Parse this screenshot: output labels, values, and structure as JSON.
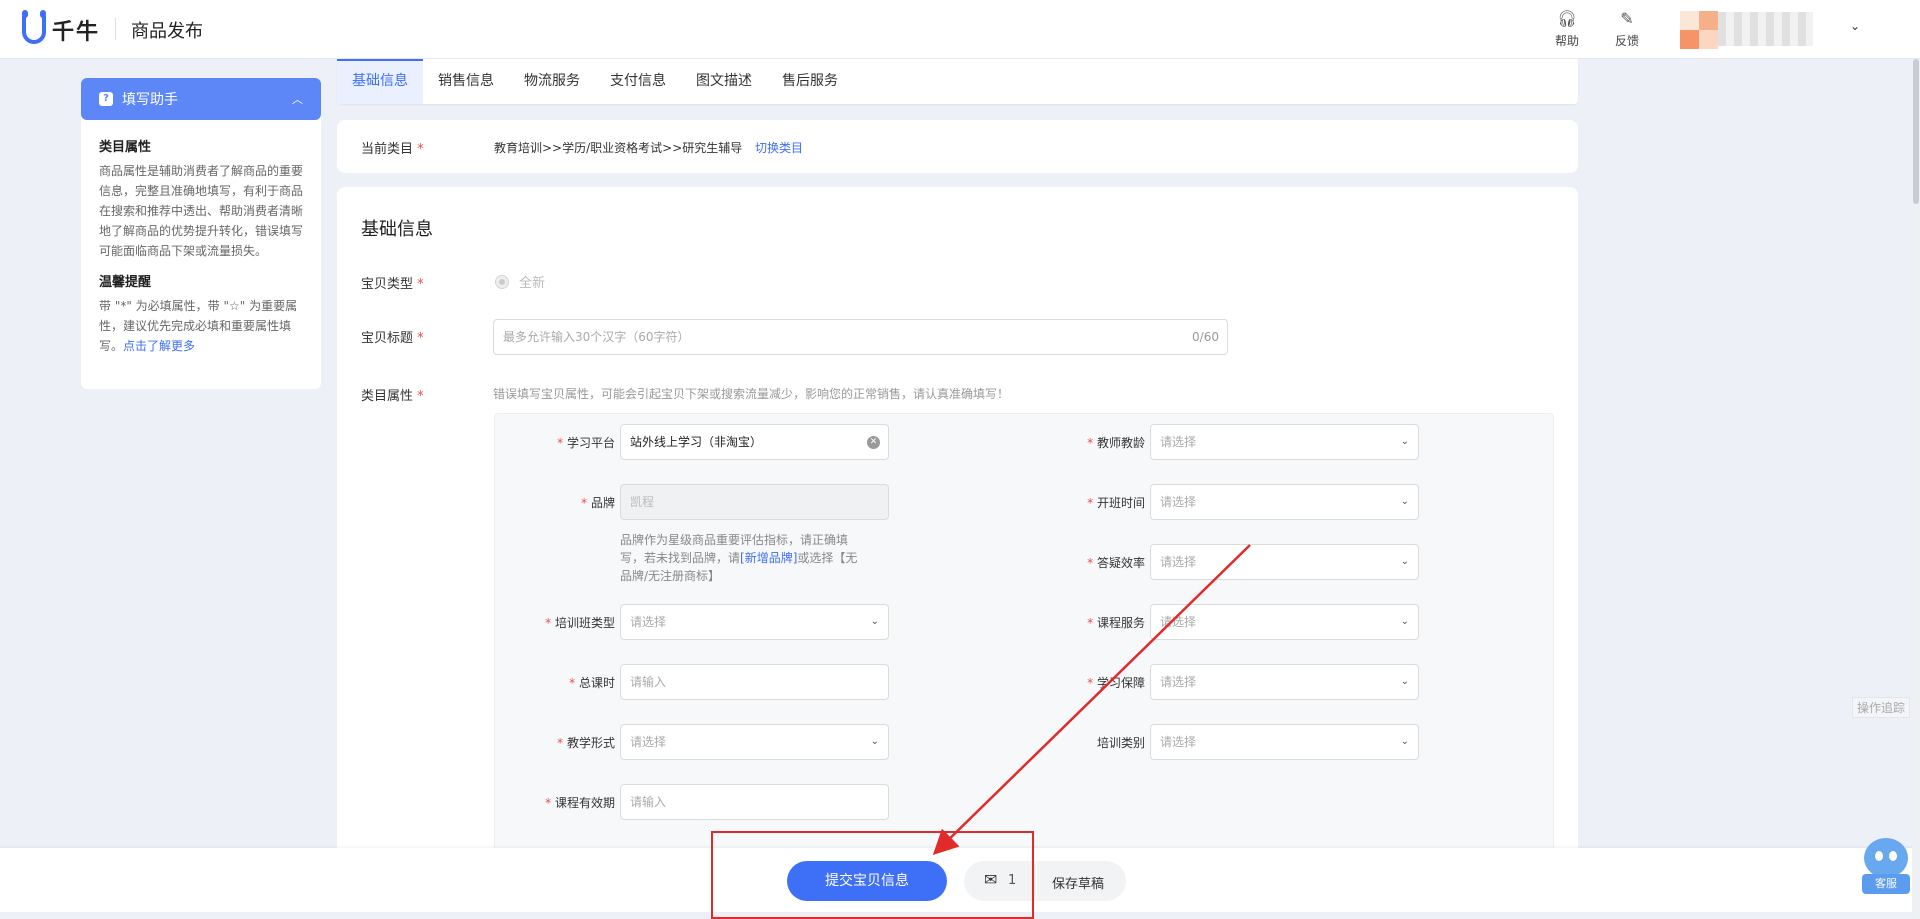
{
  "header": {
    "logo_text": "千牛",
    "page_title": "商品发布",
    "help_label": "帮助",
    "feedback_label": "反馈"
  },
  "helper": {
    "title": "填写助手",
    "sections": [
      {
        "heading": "类目属性",
        "text": "商品属性是辅助消费者了解商品的重要信息，完整且准确地填写，有利于商品在搜索和推荐中透出、帮助消费者清晰地了解商品的优势提升转化，错误填写可能面临商品下架或流量损失。"
      },
      {
        "heading": "温馨提醒",
        "text": "带 \"*\" 为必填属性，带 \"☆\" 为重要属性，建议优先完成必填和重要属性填写。",
        "link": "点击了解更多"
      }
    ]
  },
  "tabs": [
    "基础信息",
    "销售信息",
    "物流服务",
    "支付信息",
    "图文描述",
    "售后服务"
  ],
  "category": {
    "label": "当前类目",
    "path": "教育培训>>学历/职业资格考试>>研究生辅导",
    "switch_label": "切换类目"
  },
  "basic": {
    "section_title": "基础信息",
    "item_type_label": "宝贝类型",
    "item_type_value": "全新",
    "title_label": "宝贝标题",
    "title_placeholder": "最多允许输入30个汉字（60字符）",
    "title_count": "0/60",
    "attr_label": "类目属性",
    "attr_tip": "错误填写宝贝属性，可能会引起宝贝下架或搜索流量减少，影响您的正常销售，请认真准确填写！"
  },
  "attributes_left": [
    {
      "label": "学习平台",
      "value": "站外线上学习（非淘宝）",
      "type": "filled"
    },
    {
      "label": "品牌",
      "value": "凯程",
      "type": "disabled"
    },
    {
      "label": "培训班类型",
      "value": "请选择",
      "type": "select"
    },
    {
      "label": "总课时",
      "value": "请输入",
      "type": "input"
    },
    {
      "label": "教学形式",
      "value": "请选择",
      "type": "select"
    },
    {
      "label": "课程有效期",
      "value": "请输入",
      "type": "input"
    }
  ],
  "brand_tip": {
    "pre": "品牌作为星级商品重要评估指标，请正确填写，若未找到品牌，请",
    "link": "[新增品牌]",
    "post": "或选择【无品牌/无注册商标】"
  },
  "attributes_right": [
    {
      "label": "教师教龄",
      "value": "请选择",
      "required": true
    },
    {
      "label": "开班时间",
      "value": "请选择",
      "required": true
    },
    {
      "label": "答疑效率",
      "value": "请选择",
      "required": true
    },
    {
      "label": "课程服务",
      "value": "请选择",
      "required": true
    },
    {
      "label": "学习保障",
      "value": "请选择",
      "required": true
    },
    {
      "label": "培训类别",
      "value": "请选择",
      "required": false
    }
  ],
  "footer": {
    "submit_label": "提交宝贝信息",
    "message_count": "1",
    "draft_label": "保存草稿"
  },
  "side": {
    "trace_label": "操作追踪",
    "service_label": "客服"
  },
  "colors": {
    "primary": "#3d6ff7",
    "required": "#f04a4a",
    "annotation": "#e12a2a"
  }
}
